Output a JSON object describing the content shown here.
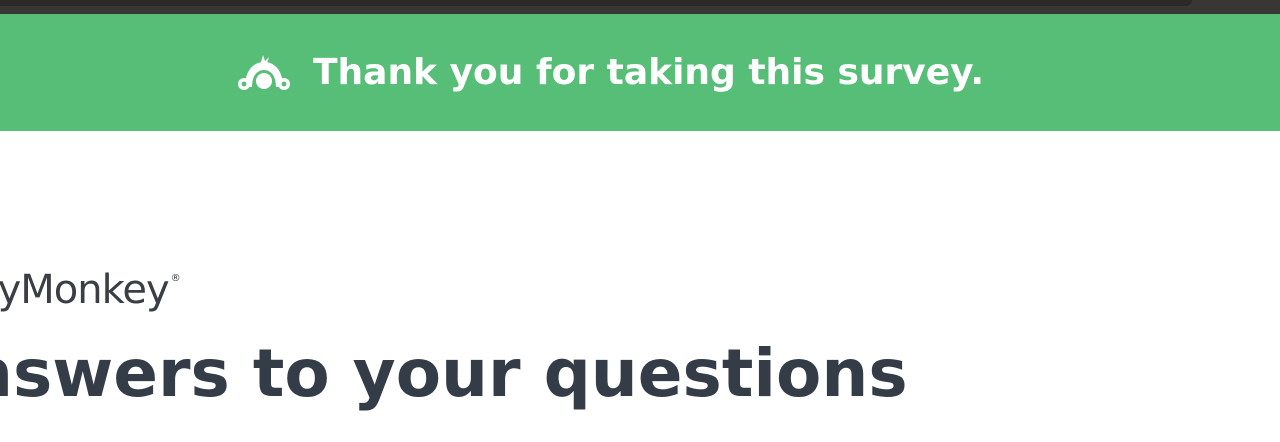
{
  "browser_bar": {
    "color": "#3a3634"
  },
  "banner": {
    "text": "Thank you for taking this survey.",
    "background": "#56be76",
    "icon": "surveymonkey-logo-icon"
  },
  "brand": {
    "text": "eyMonkey",
    "registered_mark": "®"
  },
  "headline": {
    "text": "nswers to your questions"
  }
}
